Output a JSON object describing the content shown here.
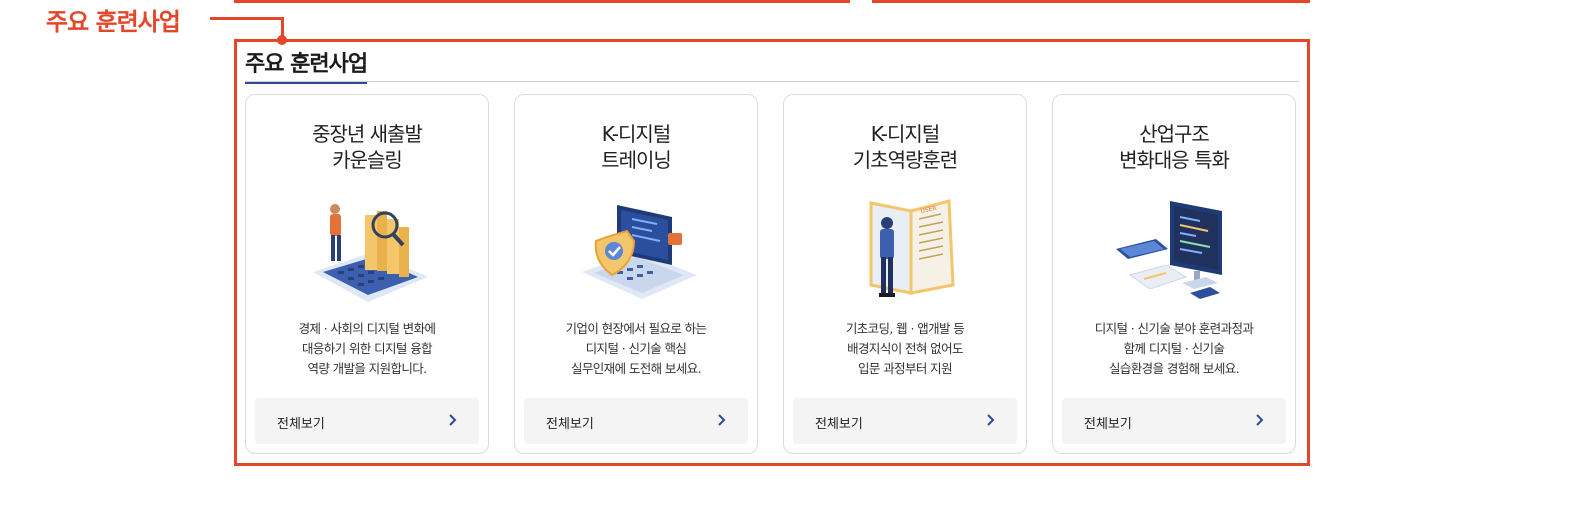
{
  "annotation": {
    "label": "주요 훈련사업",
    "color": "#e4462a"
  },
  "section": {
    "title": "주요 훈련사업",
    "accent": "#2c4b9b"
  },
  "cards": [
    {
      "title": "중장년 새출발\n카운슬링",
      "description": "경제 · 사회의 디지털 변화에\n대응하기 위한 디지털 융합\n역량 개발을 지원합니다.",
      "illustration": "person-magnifier-books-laptop",
      "button_label": "전체보기",
      "button_icon": "chevron-right-icon"
    },
    {
      "title": "K-디지털\n트레이닝",
      "description": "기업이 현장에서 필요로 하는\n디지털 · 신기술 핵심\n실무인재에 도전해 보세요.",
      "illustration": "laptop-security-shield",
      "button_label": "전체보기",
      "button_icon": "chevron-right-icon"
    },
    {
      "title": "K-디지털\n기초역량훈련",
      "description": "기초코딩, 웹 · 앱개발 등\n배경지식이 전혀 없어도\n입문 과정부터 지원",
      "illustration": "person-reading-manual",
      "button_label": "전체보기",
      "button_icon": "chevron-right-icon"
    },
    {
      "title": "산업구조\n변화대응 특화",
      "description": "디지털 · 신기술 분야 훈련과정과\n함께 디지털 · 신기술\n실습환경을 경험해 보세요.",
      "illustration": "monitor-tablet-devices",
      "button_label": "전체보기",
      "button_icon": "chevron-right-icon"
    }
  ]
}
